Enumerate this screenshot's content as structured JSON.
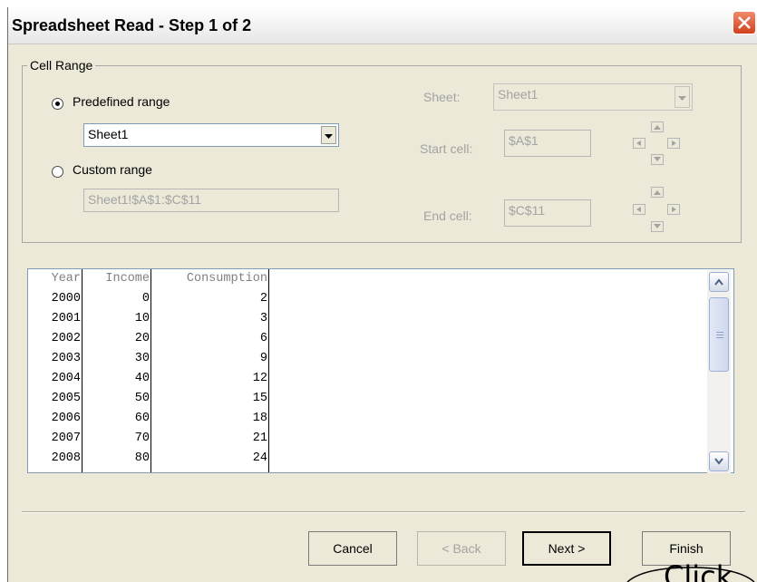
{
  "window": {
    "title": "Spreadsheet Read - Step 1 of 2"
  },
  "cell_range": {
    "legend": "Cell Range",
    "predefined_label": "Predefined range",
    "predefined_selected": true,
    "predefined_value": "Sheet1",
    "custom_label": "Custom range",
    "custom_value": "Sheet1!$A$1:$C$11",
    "sheet_label": "Sheet:",
    "sheet_value": "Sheet1",
    "start_label": "Start cell:",
    "start_value": "$A$1",
    "end_label": "End cell:",
    "end_value": "$C$11"
  },
  "table": {
    "columns": [
      "Year",
      "Income",
      "Consumption"
    ],
    "rows": [
      [
        "2000",
        "0",
        "2"
      ],
      [
        "2001",
        "10",
        "3"
      ],
      [
        "2002",
        "20",
        "6"
      ],
      [
        "2003",
        "30",
        "9"
      ],
      [
        "2004",
        "40",
        "12"
      ],
      [
        "2005",
        "50",
        "15"
      ],
      [
        "2006",
        "60",
        "18"
      ],
      [
        "2007",
        "70",
        "21"
      ],
      [
        "2008",
        "80",
        "24"
      ]
    ]
  },
  "buttons": {
    "cancel": "Cancel",
    "back": "< Back",
    "next": "Next >",
    "finish": "Finish"
  },
  "annotation": {
    "text": "Click"
  },
  "colors": {
    "close_button": "#d2401c",
    "title_bar": "#f0f0f0",
    "dialog_bg": "#ece9d8"
  }
}
